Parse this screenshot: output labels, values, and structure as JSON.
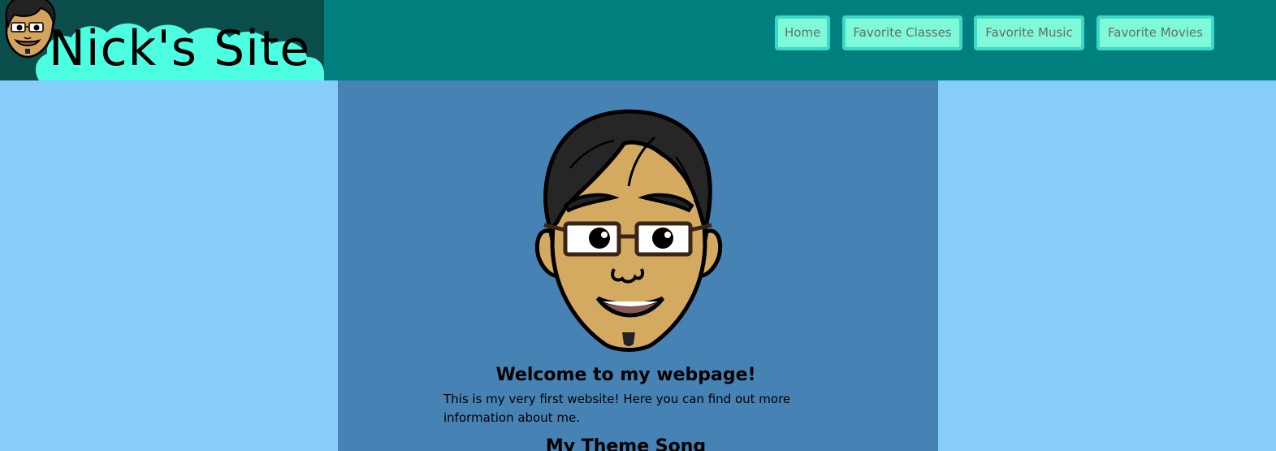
{
  "header": {
    "site_title": "Nick's Site",
    "logo_face_icon": "cartoon-avatar-icon",
    "background_color": "#007f7f",
    "logo_background_color": "#0a4d4a",
    "logo_cloud_color": "#4cffe0"
  },
  "nav": {
    "items": [
      {
        "label": "Home"
      },
      {
        "label": "Favorite Classes"
      },
      {
        "label": "Favorite Music"
      },
      {
        "label": "Favorite Movies"
      }
    ],
    "button_color": "#7ffad8",
    "button_border_color": "#3ed8c6",
    "text_color": "#6a6a6a"
  },
  "main": {
    "avatar_icon": "cartoon-avatar-icon",
    "welcome_heading": "Welcome to my webpage!",
    "intro_text": "This is my very first website! Here you can find out more information about me.",
    "theme_heading": "My Theme Song",
    "background_color": "#4682b4"
  },
  "page": {
    "background_color": "#87cdfa"
  }
}
